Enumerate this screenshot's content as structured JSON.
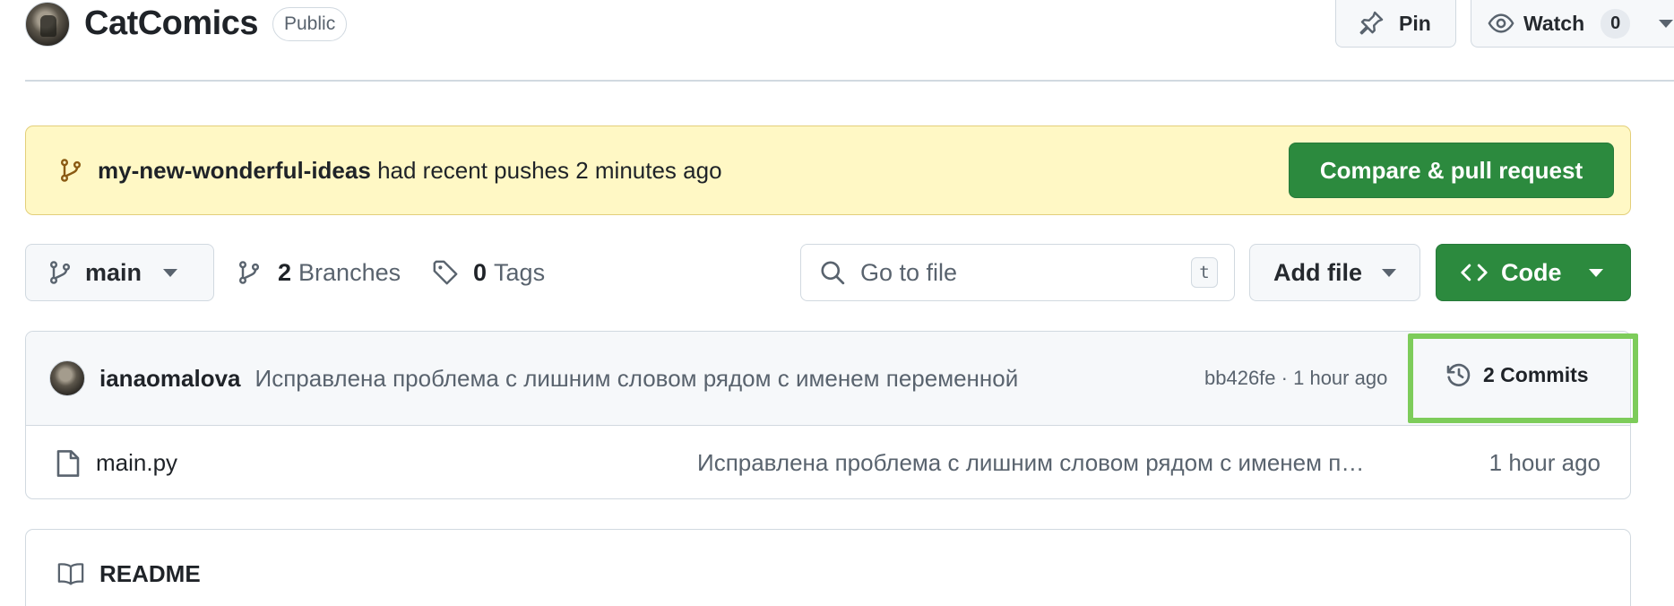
{
  "repo": {
    "name": "CatComics",
    "visibility": "Public"
  },
  "header": {
    "pin_label": "Pin",
    "watch_label": "Watch",
    "watch_count": "0"
  },
  "banner": {
    "branch": "my-new-wonderful-ideas",
    "message": "had recent pushes 2 minutes ago",
    "button_label": "Compare & pull request"
  },
  "toolbar": {
    "branch": "main",
    "branches_count": "2",
    "branches_label": "Branches",
    "tags_count": "0",
    "tags_label": "Tags",
    "search_placeholder": "Go to file",
    "search_shortcut": "t",
    "add_file_label": "Add file",
    "code_label": "Code"
  },
  "latest_commit": {
    "author": "ianaomalova",
    "message": "Исправлена проблема с лишним словом рядом с именем переменной",
    "hash": "bb426fe",
    "separator": "·",
    "time": "1 hour ago",
    "commits_label": "2 Commits"
  },
  "files": [
    {
      "name": "main.py",
      "message": "Исправлена проблема с лишним словом рядом с именем переменной",
      "time": "1 hour ago"
    }
  ],
  "readme": {
    "title": "README"
  },
  "colors": {
    "accent_green": "#2c8a3e",
    "banner_bg": "#fff8c5",
    "highlight": "#7dcc5a"
  },
  "icons": {
    "pin": "pin-icon",
    "watch": "eye-icon",
    "branch": "git-branch-icon",
    "tag": "tag-icon",
    "search": "search-icon",
    "code": "code-icon",
    "history": "history-icon",
    "file": "file-icon",
    "book": "book-icon"
  }
}
